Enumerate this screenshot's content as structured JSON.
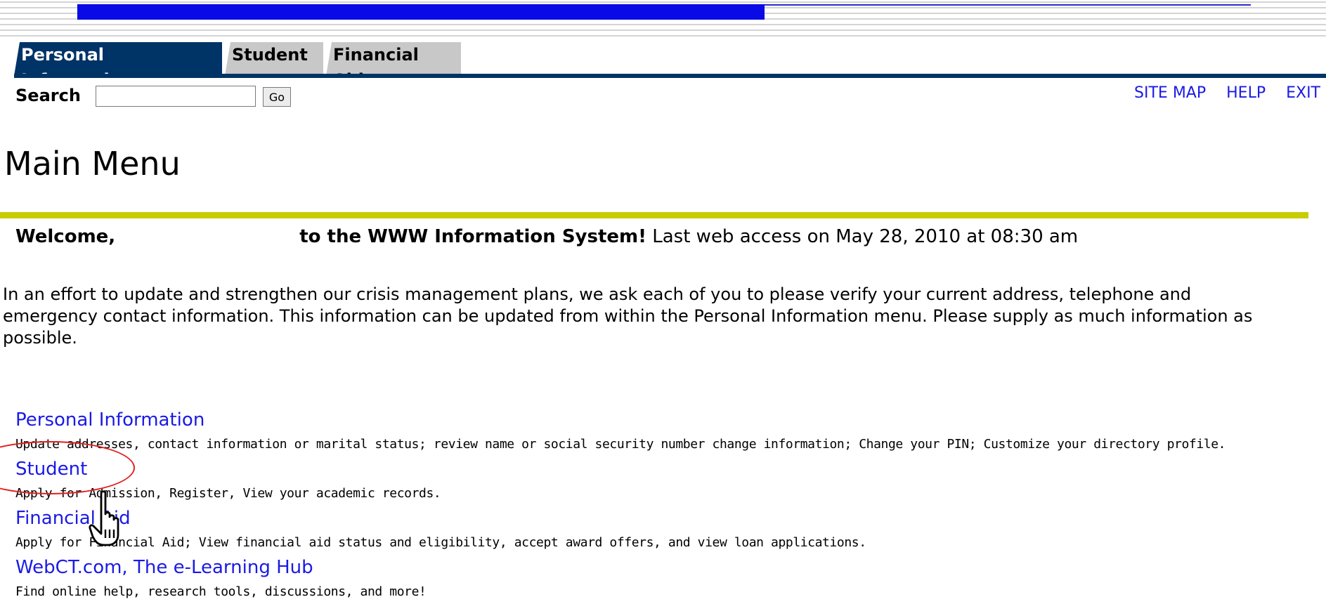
{
  "tabs": [
    {
      "label": "Personal Information",
      "active": true
    },
    {
      "label": "Student",
      "active": false
    },
    {
      "label": "Financial Aid",
      "active": false
    }
  ],
  "search": {
    "label": "Search",
    "value": "",
    "go_label": "Go"
  },
  "top_links": [
    "SITE MAP",
    "HELP",
    "EXIT"
  ],
  "page_title": "Main Menu",
  "welcome": {
    "prefix": "Welcome,",
    "system": "to the WWW Information System!",
    "last_access": "Last web access on May 28, 2010 at 08:30 am"
  },
  "notice": "In an effort to update and strengthen our crisis management plans, we ask each of you to please verify your current address, telephone and emergency contact information. This information can be updated from within the Personal Information menu. Please supply as much information as possible.",
  "menu": [
    {
      "title": "Personal Information",
      "description": "Update addresses, contact information or marital status; review name or social security number change information; Change your PIN; Customize your directory profile."
    },
    {
      "title": "Student",
      "description": "Apply for Admission, Register, View your academic records."
    },
    {
      "title": "Financial Aid",
      "description": "Apply for Financial Aid; View financial aid status and eligibility, accept award offers, and view loan applications."
    },
    {
      "title": "WebCT.com, The e-Learning Hub",
      "description": "Find online help, research tools, discussions, and more!"
    }
  ],
  "colors": {
    "tab_active": "#003366",
    "tab_inactive": "#c8c8c8",
    "link": "#1a1ae6",
    "rule": "#c8cc00",
    "annotation": "#e02020"
  }
}
